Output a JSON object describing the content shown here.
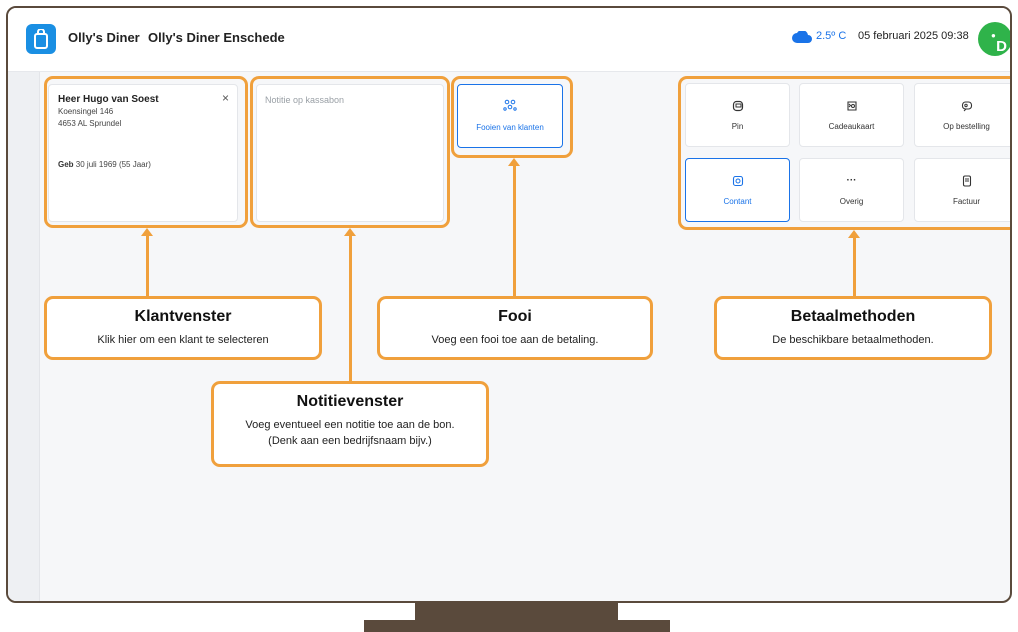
{
  "header": {
    "app_name": "Olly's Diner",
    "location": "Olly's Diner Enschede",
    "temperature": "2.5º C",
    "datetime": "05 februari 2025 09:38",
    "avatar_initial": "D",
    "brand_color": "#1a8fe3",
    "avatar_color": "#2fb34a"
  },
  "customer": {
    "name": "Heer Hugo van Soest",
    "street": "Koensingel 146",
    "city": "4653 AL Sprundel",
    "dob_label": "Geb",
    "dob_value": "30 juli 1969 (55 Jaar)",
    "close_icon": "×"
  },
  "note": {
    "placeholder": "Notitie op kassabon"
  },
  "tip": {
    "label": "Fooien van klanten"
  },
  "payment_methods": [
    {
      "label": "Pin",
      "icon": "card-icon"
    },
    {
      "label": "Cadeaukaart",
      "icon": "gift-card-icon"
    },
    {
      "label": "Op bestelling",
      "icon": "order-icon"
    },
    {
      "label": "Contant",
      "icon": "cash-icon",
      "selected": true
    },
    {
      "label": "Overig",
      "icon": "more-icon"
    },
    {
      "label": "Factuur",
      "icon": "invoice-icon"
    }
  ],
  "callouts": {
    "customer": {
      "title": "Klantvenster",
      "desc": "Klik hier om een klant te selecteren"
    },
    "note": {
      "title": "Notitievenster",
      "desc": "Voeg eventueel een notitie toe aan de bon. (Denk aan een bedrijfsnaam bijv.)"
    },
    "tip": {
      "title": "Fooi",
      "desc": "Voeg een fooi toe aan de betaling."
    },
    "payment": {
      "title": "Betaalmethoden",
      "desc": "De beschikbare betaalmethoden."
    }
  },
  "colors": {
    "accent": "#1a73e8",
    "highlight": "#f0a03c",
    "frame": "#5a4a3c"
  }
}
